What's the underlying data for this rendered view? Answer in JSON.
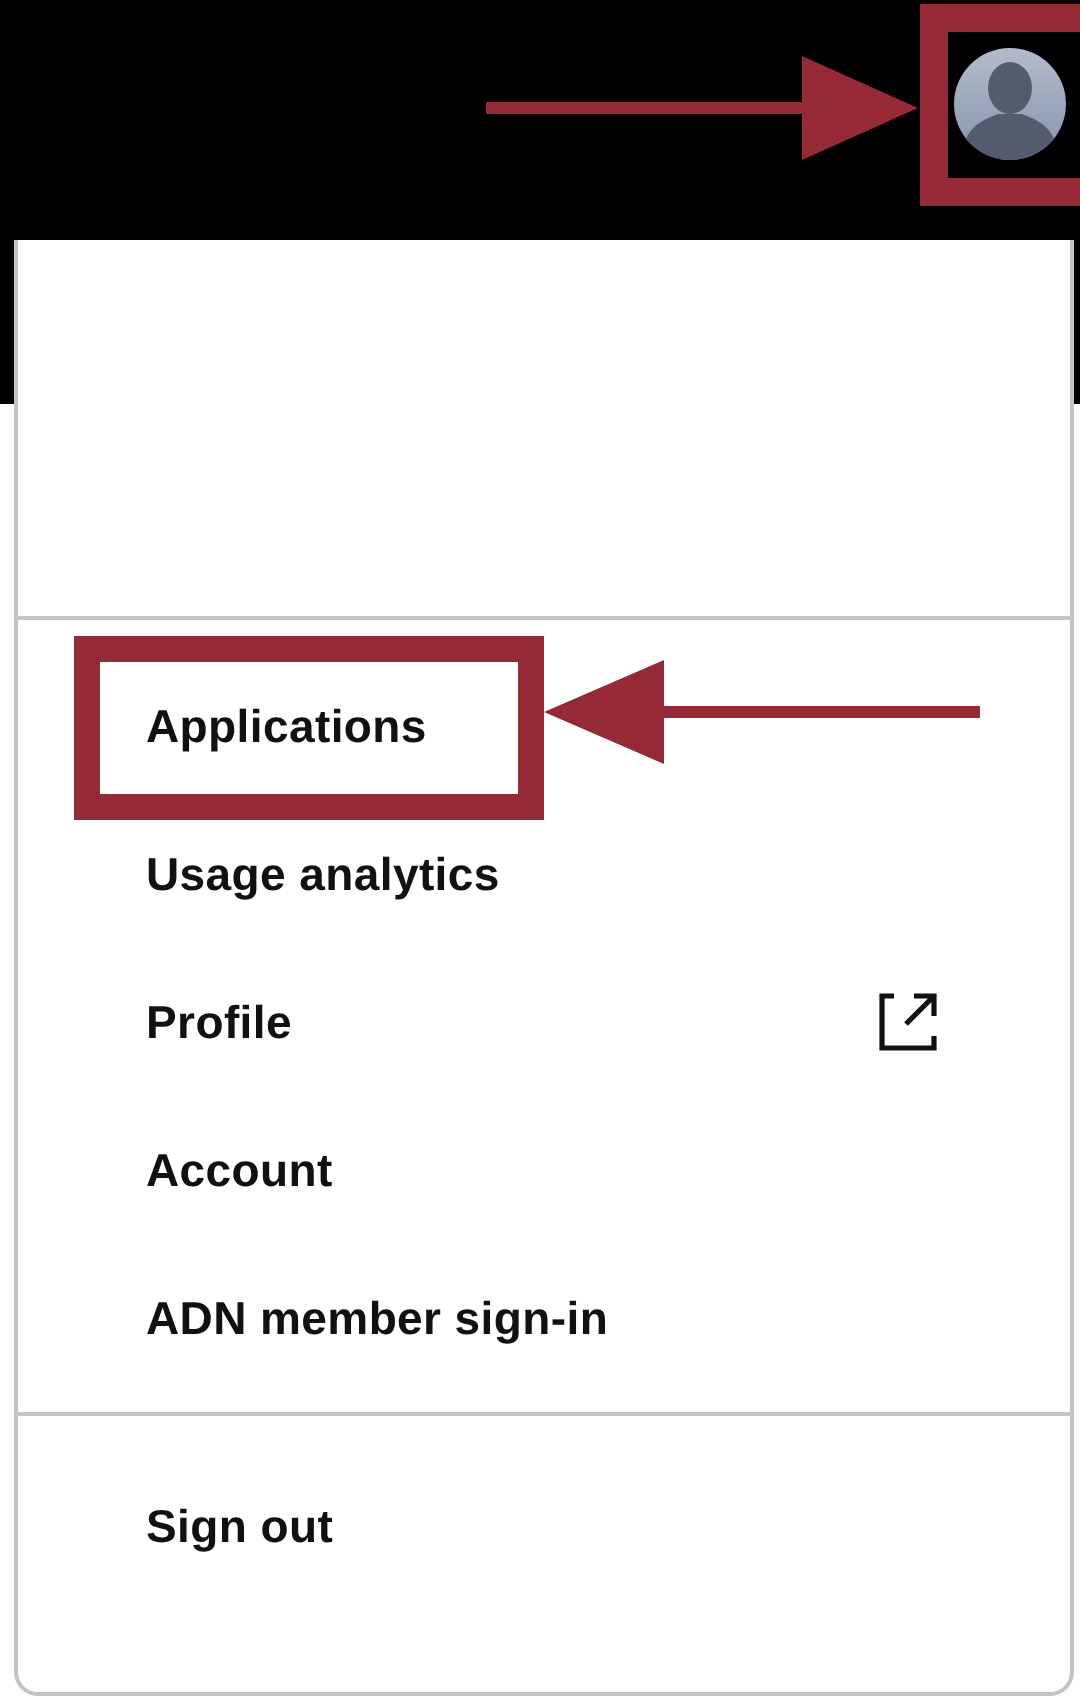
{
  "header": {
    "avatar": {
      "annotated": true
    }
  },
  "menu": {
    "sections": [
      [
        {
          "label": "Applications",
          "kind": "link",
          "annotated": true
        },
        {
          "label": "Usage analytics",
          "kind": "link",
          "annotated": false
        },
        {
          "label": "Profile",
          "kind": "external",
          "annotated": false
        },
        {
          "label": "Account",
          "kind": "link",
          "annotated": false
        },
        {
          "label": "ADN member sign-in",
          "kind": "link",
          "annotated": false
        }
      ],
      [
        {
          "label": "Sign out",
          "kind": "link",
          "annotated": false
        }
      ]
    ]
  }
}
